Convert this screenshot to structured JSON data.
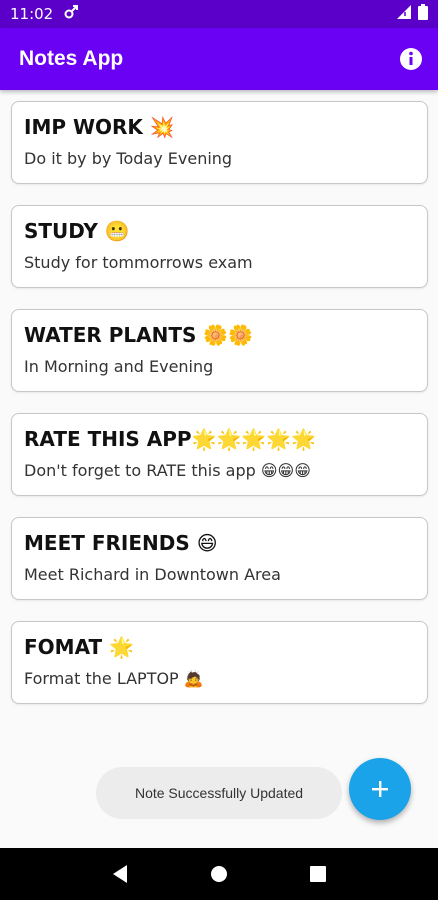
{
  "status_bar": {
    "time": "11:02",
    "icons": [
      "notification-icon",
      "signal-icon",
      "battery-icon"
    ]
  },
  "app_bar": {
    "title": "Notes App",
    "info_icon": "info-icon",
    "color": "#6a00f4"
  },
  "notes": [
    {
      "title": "IMP WORK 💥",
      "body": "Do it by by Today Evening"
    },
    {
      "title": "STUDY 😬",
      "body": "Study for tommorrows exam"
    },
    {
      "title": "WATER PLANTS 🌼🌼",
      "body": "In Morning and Evening"
    },
    {
      "title": "RATE THIS APP🌟🌟🌟🌟🌟",
      "body": "Don't forget to RATE this app 😁😁😁"
    },
    {
      "title": "MEET FRIENDS 😄",
      "body": "Meet Richard in Downtown Area"
    },
    {
      "title": "FOMAT 🌟",
      "body": "Format the LAPTOP 🙇"
    }
  ],
  "toast": {
    "message": "Note Successfully Updated"
  },
  "fab": {
    "icon": "plus-icon",
    "color": "#1aa3e8"
  },
  "nav_bar": {
    "buttons": [
      "back-icon",
      "home-icon",
      "recents-icon"
    ]
  }
}
